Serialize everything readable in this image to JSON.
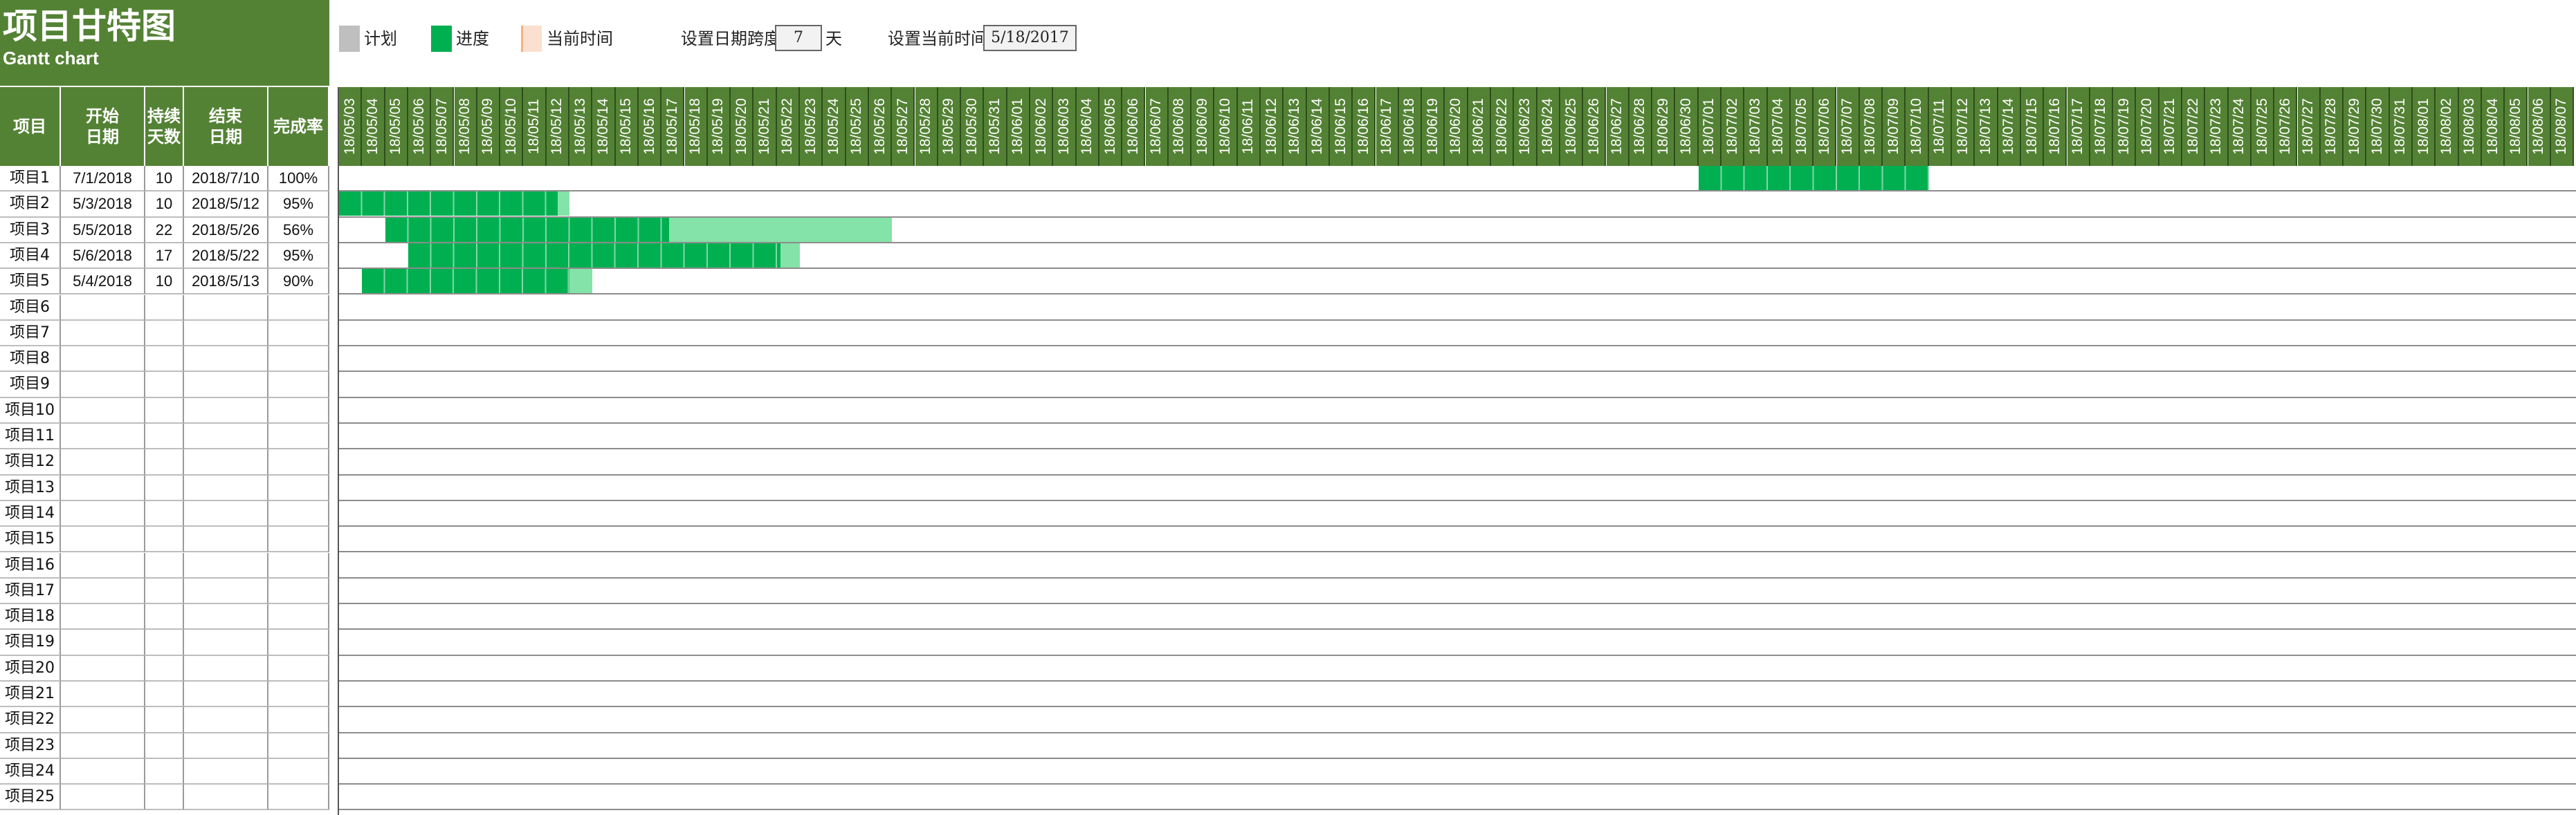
{
  "title": {
    "cn": "项目甘特图",
    "en": "Gantt chart"
  },
  "legend": {
    "plan_label": "计划",
    "progress_label": "进度",
    "current_label": "当前时间",
    "plan_color": "#bfbfbf",
    "progress_color": "#00b050",
    "current_color": "#fbe0cf"
  },
  "controls": {
    "span_label": "设置日期跨度",
    "span_value": "7",
    "span_unit": "天",
    "current_label": "设置当前时间",
    "current_value": "5/18/2017"
  },
  "table_headers": {
    "project": "项目",
    "start": "开始\n日期",
    "duration": "持续\n天数",
    "end": "结束\n日期",
    "completion": "完成率"
  },
  "projects": [
    {
      "name": "项目1",
      "start": "7/1/2018",
      "days": "10",
      "end": "2018/7/10",
      "pct": "100%"
    },
    {
      "name": "项目2",
      "start": "5/3/2018",
      "days": "10",
      "end": "2018/5/12",
      "pct": "95%"
    },
    {
      "name": "项目3",
      "start": "5/5/2018",
      "days": "22",
      "end": "2018/5/26",
      "pct": "56%"
    },
    {
      "name": "项目4",
      "start": "5/6/2018",
      "days": "17",
      "end": "2018/5/22",
      "pct": "95%"
    },
    {
      "name": "项目5",
      "start": "5/4/2018",
      "days": "10",
      "end": "2018/5/13",
      "pct": "90%"
    },
    {
      "name": "项目6",
      "start": "",
      "days": "",
      "end": "",
      "pct": ""
    },
    {
      "name": "项目7",
      "start": "",
      "days": "",
      "end": "",
      "pct": ""
    },
    {
      "name": "项目8",
      "start": "",
      "days": "",
      "end": "",
      "pct": ""
    },
    {
      "name": "项目9",
      "start": "",
      "days": "",
      "end": "",
      "pct": ""
    },
    {
      "name": "项目10",
      "start": "",
      "days": "",
      "end": "",
      "pct": ""
    },
    {
      "name": "项目11",
      "start": "",
      "days": "",
      "end": "",
      "pct": ""
    },
    {
      "name": "项目12",
      "start": "",
      "days": "",
      "end": "",
      "pct": ""
    },
    {
      "name": "项目13",
      "start": "",
      "days": "",
      "end": "",
      "pct": ""
    },
    {
      "name": "项目14",
      "start": "",
      "days": "",
      "end": "",
      "pct": ""
    },
    {
      "name": "项目15",
      "start": "",
      "days": "",
      "end": "",
      "pct": ""
    },
    {
      "name": "项目16",
      "start": "",
      "days": "",
      "end": "",
      "pct": ""
    },
    {
      "name": "项目17",
      "start": "",
      "days": "",
      "end": "",
      "pct": ""
    },
    {
      "name": "项目18",
      "start": "",
      "days": "",
      "end": "",
      "pct": ""
    },
    {
      "name": "项目19",
      "start": "",
      "days": "",
      "end": "",
      "pct": ""
    },
    {
      "name": "项目20",
      "start": "",
      "days": "",
      "end": "",
      "pct": ""
    },
    {
      "name": "项目21",
      "start": "",
      "days": "",
      "end": "",
      "pct": ""
    },
    {
      "name": "项目22",
      "start": "",
      "days": "",
      "end": "",
      "pct": ""
    },
    {
      "name": "项目23",
      "start": "",
      "days": "",
      "end": "",
      "pct": ""
    },
    {
      "name": "项目24",
      "start": "",
      "days": "",
      "end": "",
      "pct": ""
    },
    {
      "name": "项目25",
      "start": "",
      "days": "",
      "end": "",
      "pct": ""
    }
  ],
  "date_columns": [
    "18/05/03",
    "18/05/04",
    "18/05/05",
    "18/05/06",
    "18/05/07",
    "18/05/08",
    "18/05/09",
    "18/05/10",
    "18/05/11",
    "18/05/12",
    "18/05/13",
    "18/05/14",
    "18/05/15",
    "18/05/16",
    "18/05/17",
    "18/05/18",
    "18/05/19",
    "18/05/20",
    "18/05/21",
    "18/05/22",
    "18/05/23",
    "18/05/24",
    "18/05/25",
    "18/05/26",
    "18/05/27",
    "18/05/28",
    "18/05/29",
    "18/05/30",
    "18/05/31",
    "18/06/01",
    "18/06/02",
    "18/06/03",
    "18/06/04",
    "18/06/05",
    "18/06/06",
    "18/06/07",
    "18/06/08",
    "18/06/09",
    "18/06/10",
    "18/06/11",
    "18/06/12",
    "18/06/13",
    "18/06/14",
    "18/06/15",
    "18/06/16",
    "18/06/17",
    "18/06/18",
    "18/06/19",
    "18/06/20",
    "18/06/21",
    "18/06/22",
    "18/06/23",
    "18/06/24",
    "18/06/25",
    "18/06/26",
    "18/06/27",
    "18/06/28",
    "18/06/29",
    "18/06/30",
    "18/07/01",
    "18/07/02",
    "18/07/03",
    "18/07/04",
    "18/07/05",
    "18/07/06",
    "18/07/07",
    "18/07/08",
    "18/07/09",
    "18/07/10",
    "18/07/11",
    "18/07/12",
    "18/07/13",
    "18/07/14",
    "18/07/15",
    "18/07/16",
    "18/07/17",
    "18/07/18",
    "18/07/19",
    "18/07/20",
    "18/07/21",
    "18/07/22",
    "18/07/23",
    "18/07/24",
    "18/07/25",
    "18/07/26",
    "18/07/27",
    "18/07/28",
    "18/07/29",
    "18/07/30",
    "18/07/31",
    "18/08/01",
    "18/08/02",
    "18/08/03",
    "18/08/04",
    "18/08/05",
    "18/08/06",
    "18/08/07"
  ]
}
